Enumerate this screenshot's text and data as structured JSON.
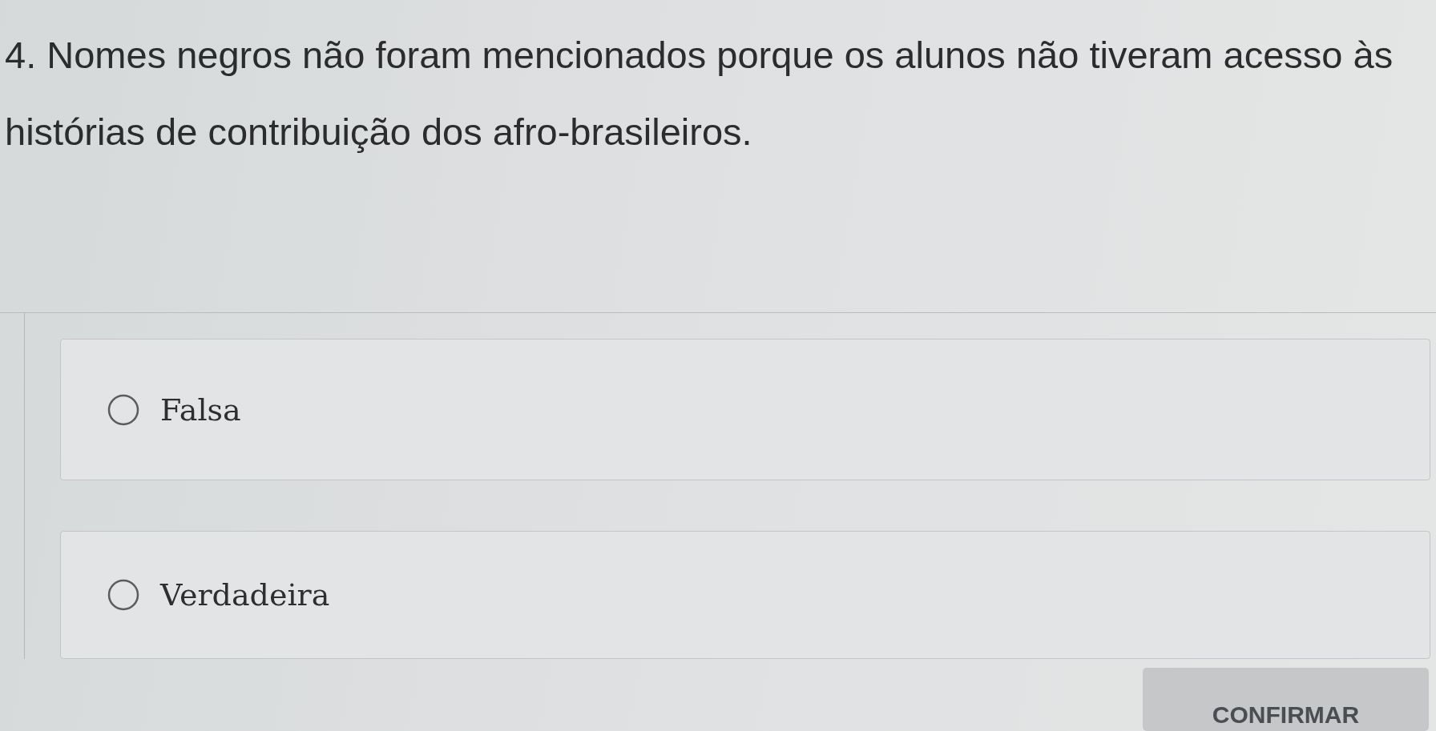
{
  "question": {
    "text": "4. Nomes negros não foram mencionados porque os alunos não tiveram acesso às histórias de contribuição dos afro-brasileiros."
  },
  "options": [
    {
      "label": "Falsa",
      "selected": false
    },
    {
      "label": "Verdadeira",
      "selected": false
    }
  ],
  "confirm_button": {
    "label": "CONFIRMAR"
  }
}
